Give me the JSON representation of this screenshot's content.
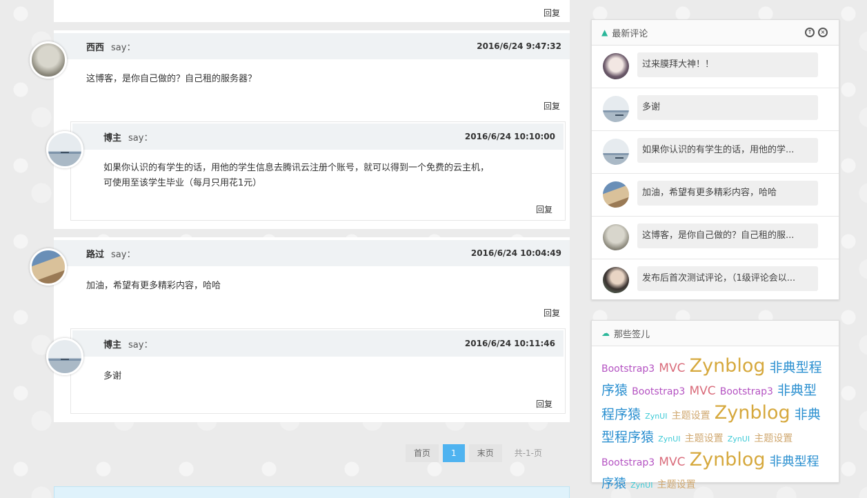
{
  "reply_label": "回复",
  "say_label": "say：",
  "comments": [
    {
      "name": "西西",
      "time": "2016/6/24 9:47:32",
      "text": "这博客，是你自己做的？自己租的服务器？",
      "reply": {
        "name": "博主",
        "time": "2016/6/24 10:10:00",
        "text_line1": "如果你认识的有学生的话，用他的学生信息去腾讯云注册个账号，就可以得到一个免费的云主机，",
        "text_line2": "可使用至该学生毕业（每月只用花1元）"
      }
    },
    {
      "name": "路过",
      "time": "2016/6/24 10:04:49",
      "text": "加油，希望有更多精彩内容，哈哈",
      "reply": {
        "name": "博主",
        "time": "2016/6/24 10:11:46",
        "text_line1": "多谢"
      }
    }
  ],
  "pager": {
    "first": "首页",
    "current": "1",
    "last": "末页",
    "total": "共-1-页"
  },
  "recent": {
    "title": "最新评论",
    "icon": "tree-icon",
    "items": [
      "过来膜拜大神！！",
      "多谢",
      "如果你认识的有学生的话，用他的学...",
      "加油，希望有更多精彩内容，哈哈",
      "这博客，是你自己做的？自己租的服...",
      "发布后首次测试评论，（1级评论会以..."
    ]
  },
  "tagpanel": {
    "title": "那些签儿",
    "icon": "cloud-icon",
    "tags": [
      {
        "text": "Bootstrap3",
        "color": "#b452c2",
        "size": 14
      },
      {
        "text": "MVC",
        "color": "#d96b7a",
        "size": 17
      },
      {
        "text": "Zynblog",
        "color": "#d6a83c",
        "size": 27
      },
      {
        "text": "非典型程序猿",
        "color": "#2a8fd0",
        "size": 19
      },
      {
        "text": "Bootstrap3",
        "color": "#b452c2",
        "size": 14
      },
      {
        "text": "MVC",
        "color": "#d96b7a",
        "size": 17
      },
      {
        "text": "Bootstrap3",
        "color": "#b452c2",
        "size": 14
      },
      {
        "text": "非典型程序猿",
        "color": "#2a8fd0",
        "size": 19
      },
      {
        "text": "ZynUI",
        "color": "#3ccad6",
        "size": 11
      },
      {
        "text": "主题设置",
        "color": "#d0a870",
        "size": 14
      },
      {
        "text": "Zynblog",
        "color": "#d6a83c",
        "size": 27
      },
      {
        "text": "非典型程序猿",
        "color": "#2a8fd0",
        "size": 19
      },
      {
        "text": "ZynUI",
        "color": "#3ccad6",
        "size": 11
      },
      {
        "text": "主题设置",
        "color": "#d0a870",
        "size": 14
      },
      {
        "text": "ZynUI",
        "color": "#3ccad6",
        "size": 11
      },
      {
        "text": "主题设置",
        "color": "#d0a870",
        "size": 14
      },
      {
        "text": "Bootstrap3",
        "color": "#b452c2",
        "size": 14
      },
      {
        "text": "MVC",
        "color": "#d96b7a",
        "size": 17
      },
      {
        "text": "Zynblog",
        "color": "#d6a83c",
        "size": 27
      },
      {
        "text": "非典型程序猿",
        "color": "#2a8fd0",
        "size": 18
      },
      {
        "text": "ZynUI",
        "color": "#3ccad6",
        "size": 11
      },
      {
        "text": "主题设置",
        "color": "#d0a870",
        "size": 14
      }
    ]
  }
}
